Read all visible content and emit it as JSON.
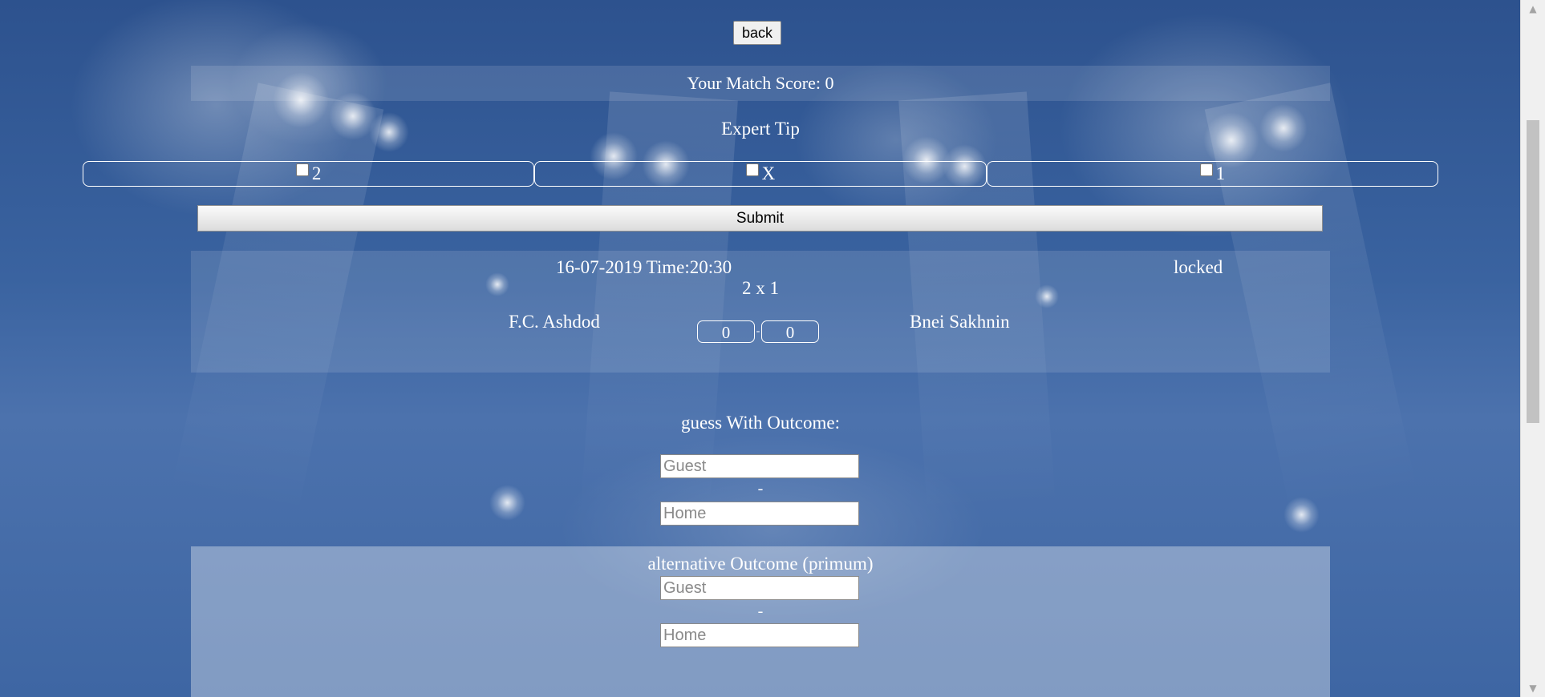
{
  "back_label": "back",
  "score_text": "Your Match Score: 0",
  "expert_tip_label": "Expert Tip",
  "tip_options": [
    {
      "label": "2",
      "checked": false
    },
    {
      "label": "X",
      "checked": false
    },
    {
      "label": "1",
      "checked": false
    }
  ],
  "submit_label": "Submit",
  "match": {
    "date_time": "16-07-2019 Time:20:30",
    "status": "locked",
    "tip_result": "2 x 1",
    "home_team": "F.C. Ashdod",
    "away_team": "Bnei Sakhnin",
    "score_left": "0",
    "score_sep": "-",
    "score_right": "0"
  },
  "guess": {
    "label": "guess With Outcome:",
    "guest_placeholder": "Guest",
    "separator": "-",
    "home_placeholder": "Home"
  },
  "alternative": {
    "label": "alternative Outcome (primum)",
    "guest_placeholder": "Guest",
    "separator": "-",
    "home_placeholder": "Home"
  },
  "scrollbar": {
    "up_icon": "chevron-up-icon",
    "down_icon": "chevron-down-icon"
  }
}
